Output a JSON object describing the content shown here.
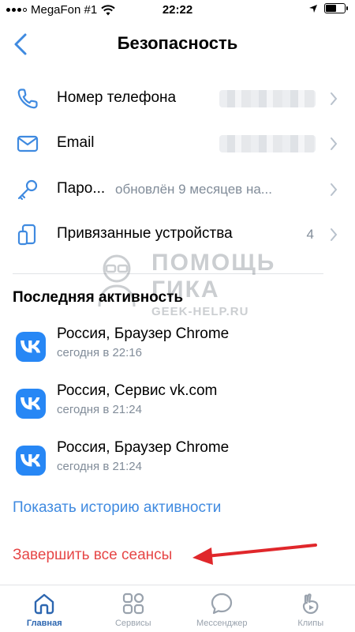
{
  "status_bar": {
    "carrier": "MegaFon #1",
    "time": "22:22",
    "battery_level": 0.55
  },
  "header": {
    "title": "Безопасность"
  },
  "settings": [
    {
      "label": "Номер телефона",
      "value": "",
      "icon": "phone-icon"
    },
    {
      "label": "Email",
      "value": "",
      "icon": "mail-icon"
    },
    {
      "label": "Паро...",
      "value": "обновлён 9 месяцев на...",
      "icon": "key-icon"
    },
    {
      "label": "Привязанные устройства",
      "value": "4",
      "icon": "devices-icon"
    }
  ],
  "activity": {
    "title": "Последняя активность",
    "sessions": [
      {
        "title": "Россия, Браузер Chrome",
        "time": "сегодня в 22:16"
      },
      {
        "title": "Россия, Сервис vk.com",
        "time": "сегодня в 21:24"
      },
      {
        "title": "Россия, Браузер Chrome",
        "time": "сегодня в 21:24"
      }
    ],
    "show_history": "Показать историю активности",
    "end_sessions": "Завершить все сеансы"
  },
  "watermark": {
    "line1": "ПОМОЩЬ",
    "line2": "ГИКА",
    "line3": "GEEK-HELP.RU"
  },
  "tabbar": [
    {
      "label": "Главная",
      "icon": "home-icon",
      "active": true
    },
    {
      "label": "Сервисы",
      "icon": "services-icon",
      "active": false
    },
    {
      "label": "Мессенджер",
      "icon": "messenger-icon",
      "active": false
    },
    {
      "label": "Клипы",
      "icon": "clips-icon",
      "active": false
    }
  ],
  "colors": {
    "accent": "#2c66b0",
    "link": "#3f8ae0",
    "danger": "#e64646",
    "secondary_text": "#818c99",
    "vk_blue": "#2787f5"
  }
}
